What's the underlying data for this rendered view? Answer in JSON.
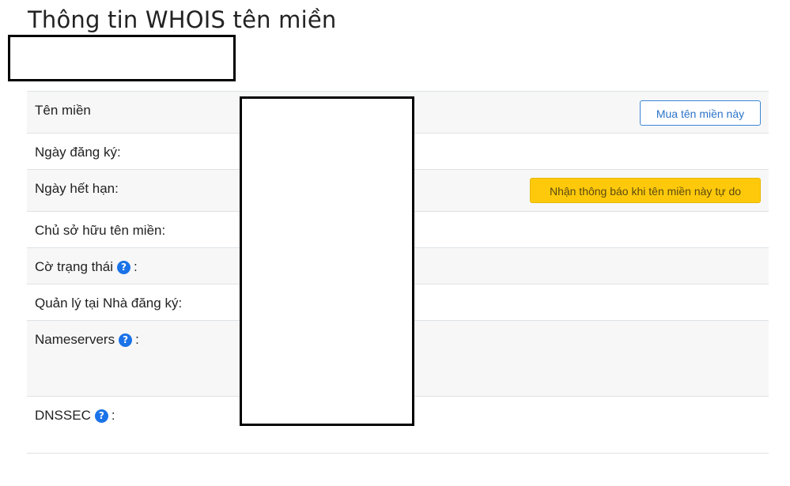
{
  "page": {
    "title": "Thông tin WHOIS tên miền"
  },
  "whois": {
    "rows": [
      {
        "label": "Tên miền",
        "help": false,
        "suffix": ""
      },
      {
        "label": "Ngày đăng ký:",
        "help": false,
        "suffix": ""
      },
      {
        "label": "Ngày hết hạn:",
        "help": false,
        "suffix": ""
      },
      {
        "label": "Chủ sở hữu tên miền:",
        "help": false,
        "suffix": ""
      },
      {
        "label": "Cờ trạng thái",
        "help": true,
        "suffix": ":"
      },
      {
        "label": "Quản lý tại Nhà đăng ký:",
        "help": false,
        "suffix": ""
      },
      {
        "label": "Nameservers",
        "help": true,
        "suffix": ":"
      },
      {
        "label": "DNSSEC",
        "help": true,
        "suffix": ":"
      }
    ],
    "help_glyph": "?"
  },
  "actions": {
    "buy_label": "Mua tên miền này",
    "notify_label": "Nhận thông báo khi tên miền này tự do"
  },
  "colors": {
    "accent": "#1a73e8",
    "warning": "#ffc90b",
    "row_shade": "#f7f7f7"
  },
  "icons": {
    "help": "question-circle-icon"
  }
}
